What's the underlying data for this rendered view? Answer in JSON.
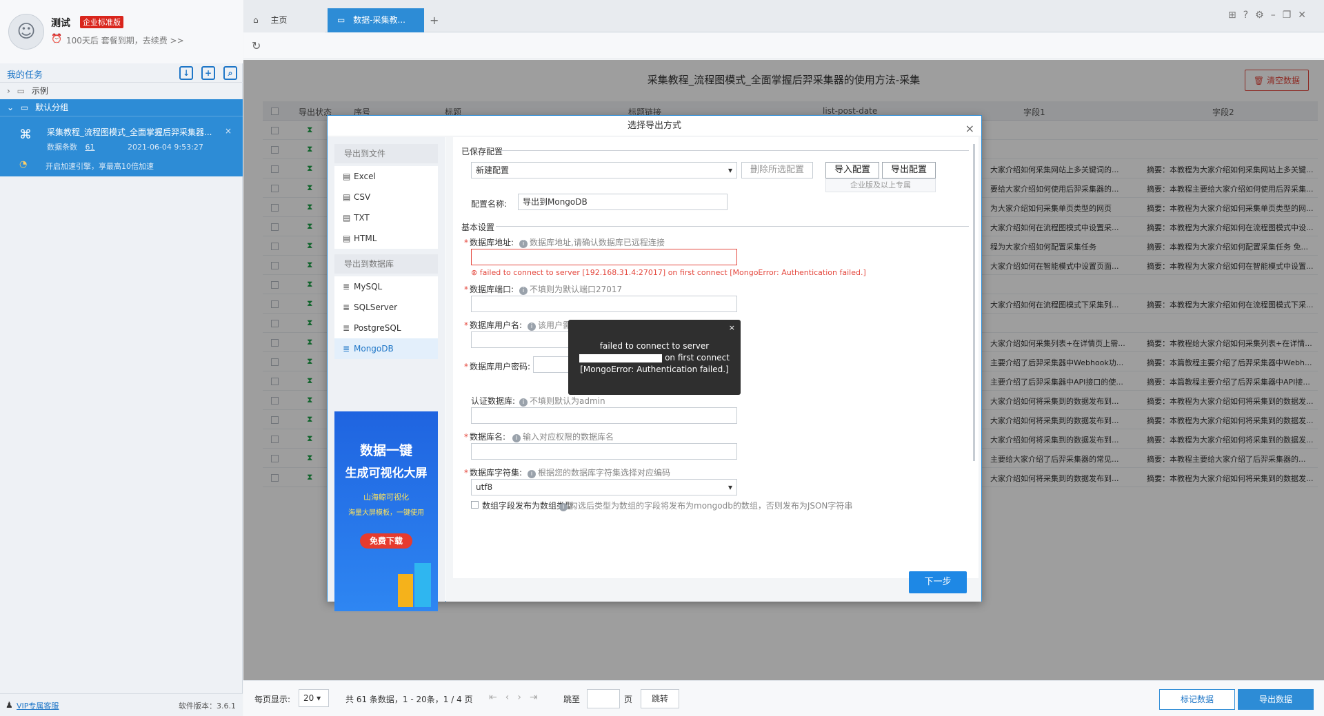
{
  "sidebar": {
    "user_name": "测试",
    "edition_badge": "企业标准版",
    "expire_text": "100天后 套餐到期，去续费 >>",
    "tasks_title": "我的任务",
    "tree": [
      {
        "label": "示例"
      },
      {
        "label": "默认分组"
      }
    ],
    "task": {
      "title": "采集教程_流程图模式_全面掌握后羿采集器...",
      "count_label": "数据条数",
      "count": "61",
      "date": "2021-06-04 9:53:27",
      "accel": "开启加速引擎，享最高10倍加速"
    },
    "vip_link": "VIP专属客服",
    "version": "软件版本：3.6.1"
  },
  "tabs": [
    {
      "label": "主页"
    },
    {
      "label": "数据-采集教..."
    }
  ],
  "main": {
    "title": "采集教程_流程图模式_全面掌握后羿采集器的使用方法-采集",
    "clear_button": "清空数据",
    "columns": [
      "导出状态",
      "序号",
      "标题",
      "标题链接",
      "list-post-date",
      "字段1",
      "字段2"
    ],
    "rows": [
      {
        "f1": "",
        "f2": ""
      },
      {
        "f1": "",
        "f2": ""
      },
      {
        "f1": "大家介绍如何采集网站上多关键词的...",
        "f2": "摘要：本教程为大家介绍如何采集网站上多关键..."
      },
      {
        "f1": "要给大家介绍如何使用后羿采集器的...",
        "f2": "摘要：本教程主要给大家介绍如何使用后羿采集..."
      },
      {
        "f1": "为大家介绍如何采集单页类型的网页",
        "f2": "摘要：本教程为大家介绍如何采集单页类型的网..."
      },
      {
        "f1": "大家介绍如何在流程图模式中设置采...",
        "f2": "摘要：本教程为大家介绍如何在流程图模式中设..."
      },
      {
        "f1": "程为大家介绍如何配置采集任务",
        "f2": "摘要：本教程为大家介绍如何配置采集任务 免..."
      },
      {
        "f1": "大家介绍如何在智能模式中设置页面...",
        "f2": "摘要：本教程为大家介绍如何在智能模式中设置..."
      },
      {
        "f1": "",
        "f2": ""
      },
      {
        "f1": "大家介绍如何在流程图模式下采集列...",
        "f2": "摘要：本教程为大家介绍如何在流程图模式下采..."
      },
      {
        "f1": "",
        "f2": ""
      },
      {
        "f1": "大家介绍如何采集列表+在详情页上需...",
        "f2": "摘要：本教程给大家介绍如何采集列表+在详情..."
      },
      {
        "f1": "主要介绍了后羿采集器中Webhook功...",
        "f2": "摘要：本篇教程主要介绍了后羿采集器中Webh..."
      },
      {
        "f1": "主要介绍了后羿采集器中API接口的使...",
        "f2": "摘要：本篇教程主要介绍了后羿采集器中API接..."
      },
      {
        "f1": "大家介绍如何将采集到的数据发布到...",
        "f2": "摘要：本教程为大家介绍如何将采集到的数据发..."
      },
      {
        "f1": "大家介绍如何将采集到的数据发布到...",
        "f2": "摘要：本教程为大家介绍如何将采集到的数据发..."
      },
      {
        "f1": "大家介绍如何将采集到的数据发布到...",
        "f2": "摘要：本教程为大家介绍如何将采集到的数据发..."
      },
      {
        "f1": "主要给大家介绍了后羿采集器的常见...",
        "f2": "摘要：本教程主要给大家介绍了后羿采集器的..."
      },
      {
        "f1": "大家介绍如何将采集到的数据发布到...",
        "f2": "摘要：本教程为大家介绍如何将采集到的数据发..."
      }
    ]
  },
  "footer": {
    "page_size_label": "每页显示:",
    "page_size": "20",
    "summary": "共 61 条数据，1 - 20条，1 / 4 页",
    "jump_label": "跳至",
    "page_unit": "页",
    "jump_button": "跳转",
    "mark_button": "标记数据",
    "export_button": "导出数据"
  },
  "modal": {
    "title": "选择导出方式",
    "file_group": "导出到文件",
    "file_options": [
      "Excel",
      "CSV",
      "TXT",
      "HTML"
    ],
    "db_group": "导出到数据库",
    "db_options": [
      "MySQL",
      "SQLServer",
      "PostgreSQL",
      "MongoDB"
    ],
    "ad": {
      "line1": "数据一键",
      "line2": "生成可视化大屏",
      "line3": "山海鲸可视化",
      "line4": "海量大屏模板，一键使用",
      "button": "免费下载"
    },
    "saved_config_label": "已保存配置",
    "config_select": "新建配置",
    "delete_config": "删除所选配置",
    "import_config": "导入配置",
    "export_config": "导出配置",
    "enterprise_note": "企业版及以上专属",
    "config_name_label": "配置名称:",
    "config_name_value": "导出到MongoDB",
    "basic_label": "基本设置",
    "db_addr_label": "数据库地址:",
    "db_addr_hint": "数据库地址,请确认数据库已远程连接",
    "db_addr_error": "failed to connect to server [192.168.31.4:27017] on first connect [MongoError: Authentication failed.]",
    "port_label": "数据库端口:",
    "port_hint": "不填则为默认端口27017",
    "user_label": "数据库用户名:",
    "user_hint": "该用户需",
    "pwd_label": "数据库用户密码:",
    "authdb_label": "认证数据库:",
    "authdb_hint": "不填则默认为admin",
    "dbname_label": "数据库名:",
    "dbname_hint": "输入对应权限的数据库名",
    "charset_label": "数据库字符集:",
    "charset_hint": "根据您的数据库字符集选择对应编码",
    "charset_value": "utf8",
    "datatype_label": "数组字段发布为数组类型",
    "datatype_hint": "勾选后类型为数组的字段将发布为mongodb的数组，否则发布为JSON字符串",
    "next_button": "下一步"
  },
  "tooltip": {
    "line1": "failed to connect to server",
    "line2": "on first connect",
    "line3": "[MongoError: Authentication failed.]"
  }
}
